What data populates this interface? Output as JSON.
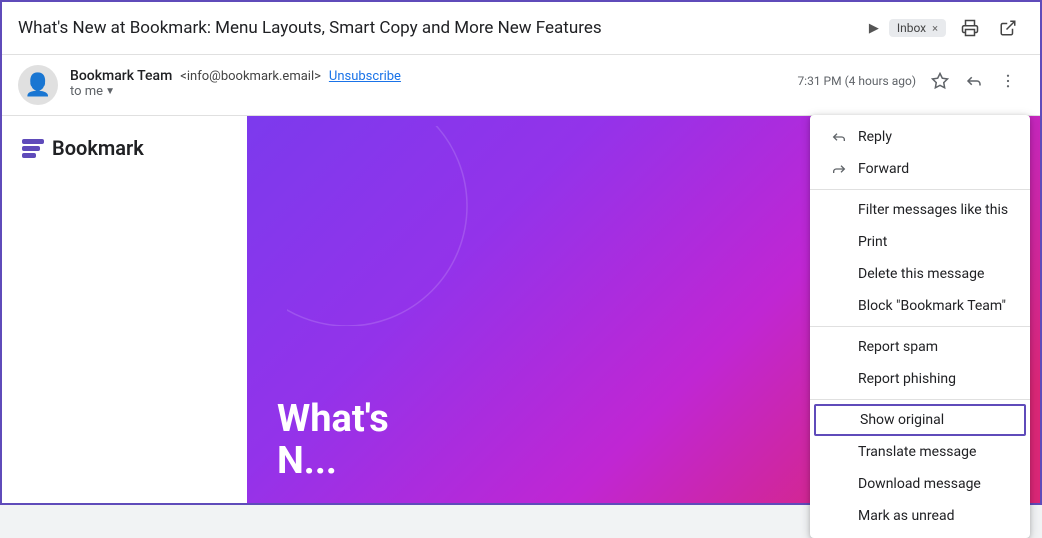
{
  "subject": {
    "text": "What's New at Bookmark: Menu Layouts, Smart Copy and More New Features",
    "inbox_label": "Inbox",
    "inbox_close": "×"
  },
  "header_icons": {
    "print_title": "Print",
    "new_window_title": "Open in new window"
  },
  "sender": {
    "name": "Bookmark Team",
    "email": "<info@bookmark.email>",
    "unsubscribe": "Unsubscribe",
    "to_label": "to me",
    "timestamp": "7:31 PM (4 hours ago)"
  },
  "logo": {
    "text": "Bookmark"
  },
  "banner": {
    "text_line1": "What's",
    "text_line2": "N..."
  },
  "menu": {
    "items": [
      {
        "id": "reply",
        "icon": "reply",
        "label": "Reply",
        "has_icon": true
      },
      {
        "id": "forward",
        "icon": "forward",
        "label": "Forward",
        "has_icon": true
      },
      {
        "id": "filter",
        "icon": "",
        "label": "Filter messages like this",
        "has_icon": false
      },
      {
        "id": "print",
        "icon": "",
        "label": "Print",
        "has_icon": false
      },
      {
        "id": "delete",
        "icon": "",
        "label": "Delete this message",
        "has_icon": false
      },
      {
        "id": "block",
        "icon": "",
        "label": "Block \"Bookmark Team\"",
        "has_icon": false
      },
      {
        "id": "report-spam",
        "icon": "",
        "label": "Report spam",
        "has_icon": false
      },
      {
        "id": "report-phishing",
        "icon": "",
        "label": "Report phishing",
        "has_icon": false
      },
      {
        "id": "show-original",
        "icon": "",
        "label": "Show original",
        "has_icon": false,
        "highlighted": true
      },
      {
        "id": "translate",
        "icon": "",
        "label": "Translate message",
        "has_icon": false
      },
      {
        "id": "download",
        "icon": "",
        "label": "Download message",
        "has_icon": false
      },
      {
        "id": "mark-unread",
        "icon": "",
        "label": "Mark as unread",
        "has_icon": false
      }
    ]
  }
}
